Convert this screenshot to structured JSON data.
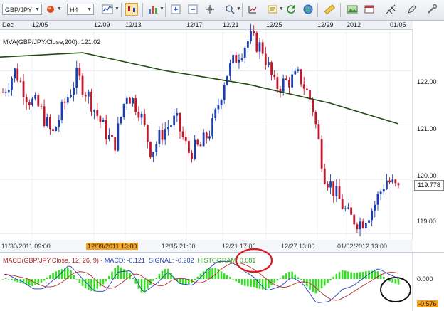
{
  "toolbar": {
    "symbol": "GBP/JPY",
    "timeframe": "H4",
    "icons": [
      "bullet-icon",
      "line-chart-icon",
      "candle-icon",
      "bar-chart-icon",
      "zoom-in-icon",
      "zoom-out-icon",
      "magnifier-icon",
      "note-icon",
      "refresh-icon",
      "globe-icon",
      "ruler-icon",
      "image-icon",
      "window-icon",
      "pitchfork-icon",
      "settings-icon"
    ]
  },
  "top_axis": [
    "Dec",
    "12/05",
    "12/09",
    "12/13",
    "12/17",
    "12/21",
    "12/25",
    "12/29",
    "2012",
    "01/05"
  ],
  "bottom_axis": [
    "11/30/2011 09:00",
    "12/09/2011 13:00",
    "12/15 21:00",
    "12/21 17:00",
    "12/27 13:00",
    "01/02/2012 13:00"
  ],
  "mva_label": "MVA(GBP/JPY.Close,200): 121.02",
  "price_axis": [
    "122.00",
    "121.00",
    "120.00",
    "119.00"
  ],
  "current_price": "119.778",
  "macd": {
    "label_prefix": "MACD(GBP/JPY.Close, 12, 26, 9) - ",
    "macd_text": "MACD: -0.121",
    "signal_text": "SIGNAL: -0.202",
    "histogram_text": "HISTOGRAM: 0.081",
    "axis_zero": "0.000",
    "axis_current": "-0.576"
  },
  "colors": {
    "up_candle": "#1c3fb0",
    "down_candle": "#c0172b",
    "mva_line": "#1f4d12",
    "histogram": "#33dd22",
    "macd_line": "#1f3fb5",
    "signal_line": "#b52b2b",
    "annotation_red": "#e3141c",
    "annotation_black": "#111111",
    "highlight": "#f6a21f"
  },
  "chart_data": {
    "type": "line",
    "title": "",
    "xlabel": "",
    "ylabel": "",
    "ylim": [
      118.95,
      122.75
    ],
    "x": [
      "11/30/2011 09:00",
      "12/09/2011 13:00",
      "12/15 21:00",
      "12/21 17:00",
      "12/27 13:00",
      "01/02/2012 13:00"
    ],
    "series": [
      {
        "name": "MVA(GBP/JPY.Close,200)",
        "values": [
          122.25,
          122.33,
          122.0,
          121.75,
          121.4,
          121.02
        ]
      }
    ],
    "price_close_approx": [
      121.9,
      121.4,
      121.0,
      122.3,
      121.8,
      119.2,
      119.8
    ],
    "price_samples": [
      121.6,
      122.0,
      121.5,
      121.3,
      120.8,
      121.4,
      121.9,
      121.5,
      121.0,
      120.6,
      121.6,
      121.3,
      120.5,
      120.9,
      121.1,
      120.5,
      120.6,
      121.0,
      121.9,
      122.3,
      122.6,
      122.4,
      121.7,
      121.8,
      121.9,
      121.4,
      120.1,
      119.7,
      119.3,
      119.2,
      119.5,
      120.0,
      119.8
    ]
  }
}
